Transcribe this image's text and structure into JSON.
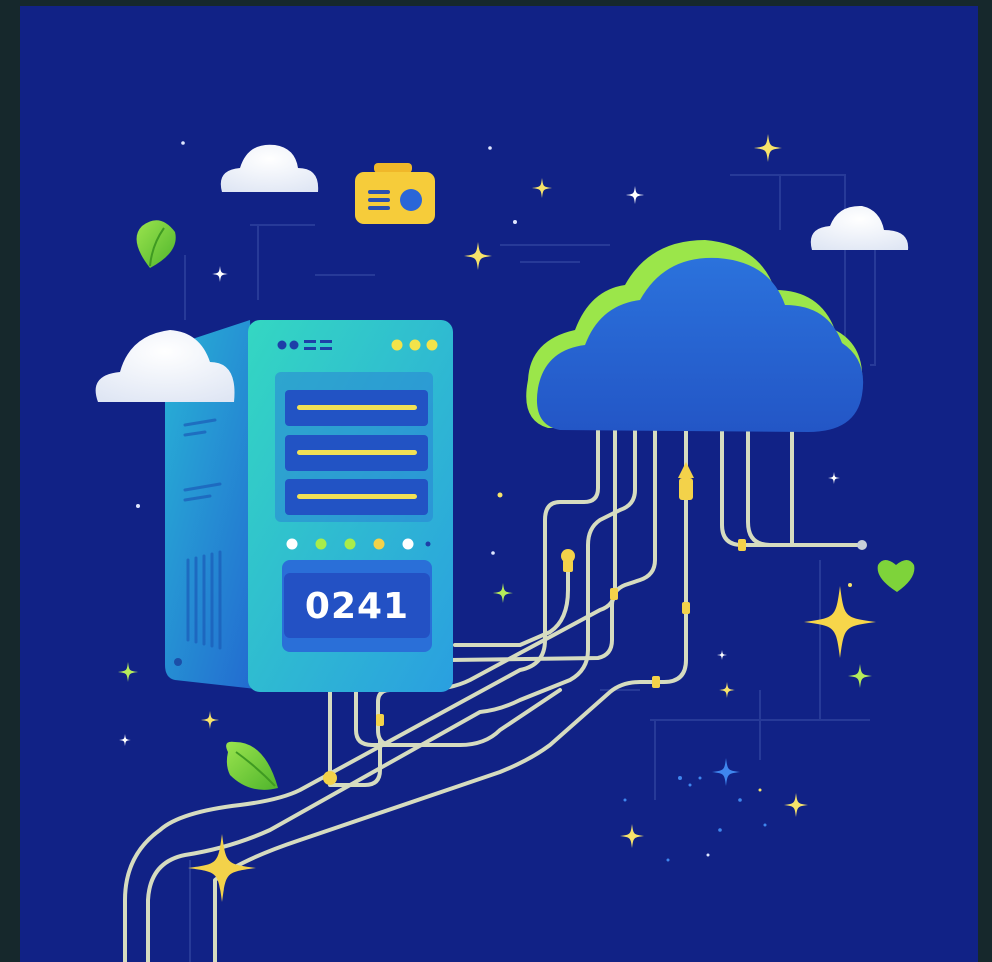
{
  "illustration": {
    "server": {
      "display_value": "0241"
    }
  },
  "colors": {
    "frame": "#16282c",
    "background": "#112286",
    "server_body": "#2fd2c9",
    "server_side": "#1f94d6",
    "cloud_main": "#2666d2",
    "cloud_rim": "#9be64a",
    "cable": "#d6dcc0",
    "sparkle": "#f7d64a",
    "leaf": "#7ed33a"
  }
}
